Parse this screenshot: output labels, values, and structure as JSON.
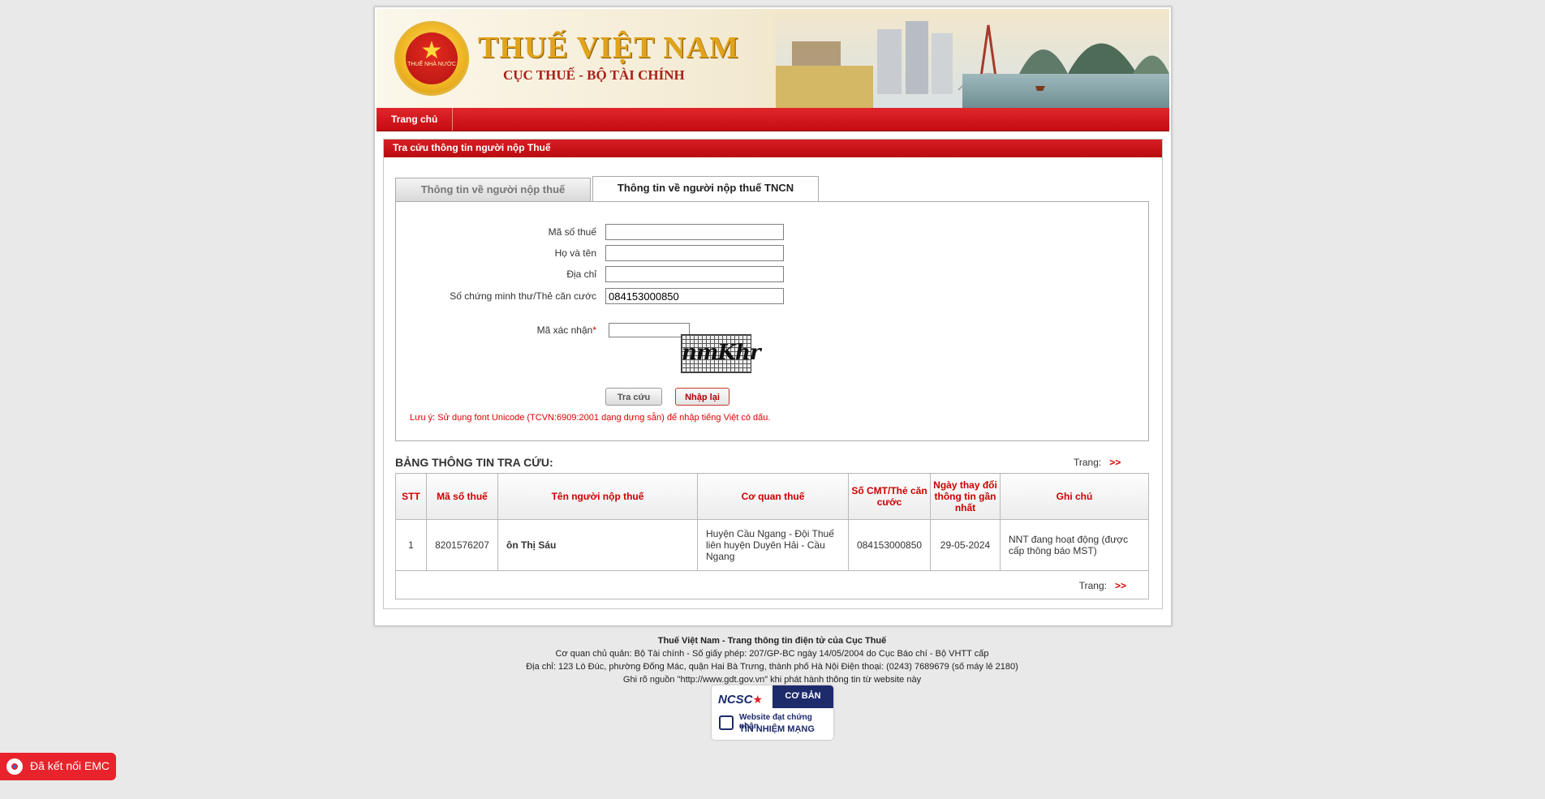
{
  "header": {
    "emblem_text": "THUẾ NHÀ NƯỚC",
    "title": "THUẾ VIỆT NAM",
    "subtitle": "CỤC THUẾ - BỘ TÀI CHÍNH"
  },
  "nav": {
    "home": "Trang chủ"
  },
  "panel": {
    "title": "Tra cứu thông tin người nộp Thuế",
    "tabs": [
      {
        "label": "Thông tin về người nộp thuế",
        "active": false
      },
      {
        "label": "Thông tin về người nộp thuế TNCN",
        "active": true
      }
    ]
  },
  "form": {
    "tax_code": {
      "label": "Mã số thuế",
      "value": ""
    },
    "full_name": {
      "label": "Họ và tên",
      "value": ""
    },
    "address": {
      "label": "Địa chỉ",
      "value": ""
    },
    "id_number": {
      "label": "Số chứng minh thư/Thẻ căn cước",
      "value": "084153000850"
    },
    "captcha": {
      "label": "Mã xác nhận",
      "required_mark": "*",
      "value": "",
      "image_text": "nmKhr"
    },
    "search_button": "Tra cứu",
    "reset_button": "Nhập lại",
    "note": "Lưu ý: Sử dụng font Unicode (TCVN:6909:2001 dạng dựng sẵn) để nhập tiếng Việt có dấu."
  },
  "results": {
    "title": "BẢNG THÔNG TIN TRA CỨU:",
    "pager_label": "Trang:",
    "pager_next": ">>",
    "columns": [
      "STT",
      "Mã số thuế",
      "Tên người nộp thuế",
      "Cơ quan thuế",
      "Số CMT/Thẻ căn cước",
      "Ngày thay đổi thông tin gần nhất",
      "Ghi chú"
    ],
    "rows": [
      {
        "stt": "1",
        "tax_code": "8201576207",
        "name": "ôn Thị Sáu",
        "agency": "Huyện Cầu Ngang - Đội Thuế liên huyện Duyên Hải - Cầu Ngang",
        "id_number": "084153000850",
        "updated": "29-05-2024",
        "note": "NNT đang hoạt động (được cấp thông báo MST)"
      }
    ]
  },
  "footer": {
    "line1": "Thuế Việt Nam - Trang thông tin điện tử của Cục Thuế",
    "line2": "Cơ quan chủ quản: Bộ Tài chính - Số giấy phép: 207/GP-BC ngày 14/05/2004 do Cục Báo chí - Bộ VHTT cấp",
    "line3": "Địa chỉ: 123 Lò Đúc, phường Đống Mác, quận Hai Bà Trưng, thành phố Hà Nội Điện thoại: (0243) 7689679 (số máy lẻ 2180)",
    "line4": "Ghi rõ nguồn \"http://www.gdt.gov.vn\" khi phát hành thông tin từ website này"
  },
  "badge": {
    "logo": "NCSC",
    "level": "CƠ BẢN",
    "line1": "Website đạt chứng nhận",
    "line2": "TÍN NHIỆM MẠNG"
  },
  "emc": {
    "label": "Đã kết nối EMC"
  },
  "colors": {
    "primary_red": "#c8101a",
    "link_red": "#d00000",
    "gold": "#e0a31a"
  }
}
